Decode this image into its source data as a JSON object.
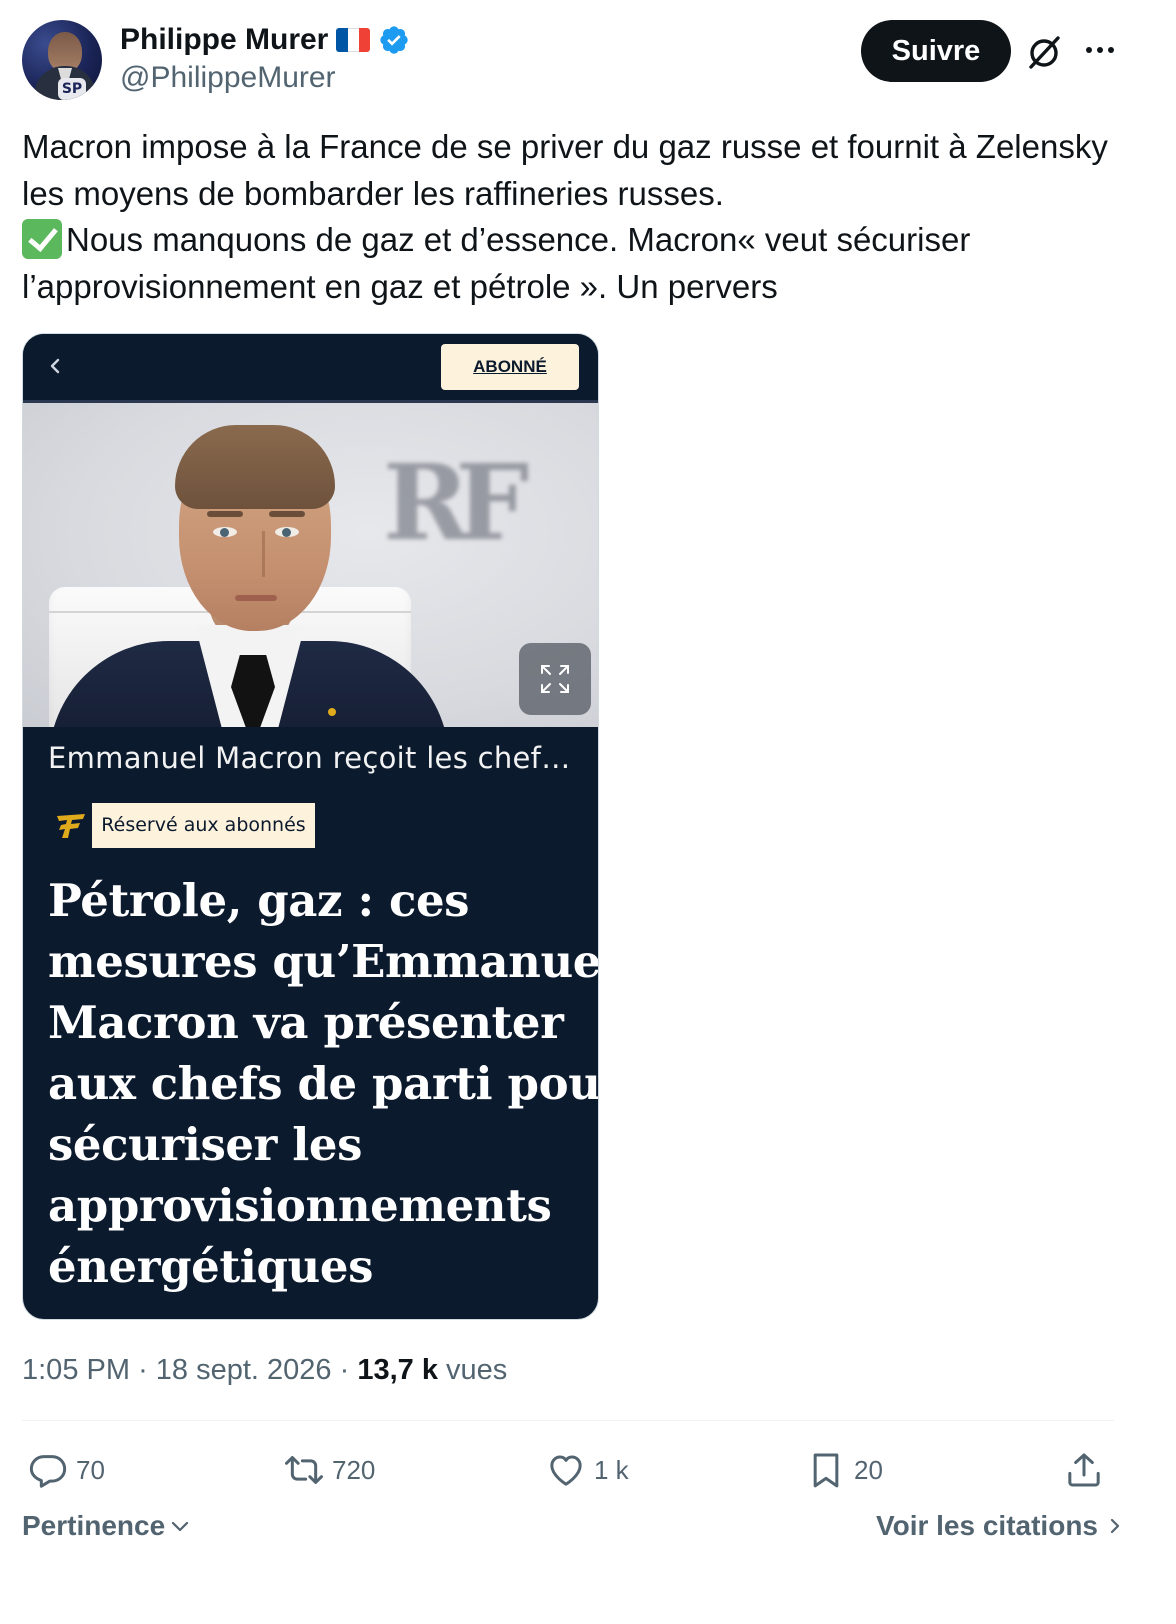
{
  "author": {
    "display_name": "Philippe Murer",
    "handle": "@PhilippeMurer",
    "avatar_badge": "SP",
    "flag_colors": [
      "#0055A4",
      "#FFFFFF",
      "#EF4135"
    ],
    "verified_color": "#1D9BF0"
  },
  "header": {
    "follow_label": "Suivre",
    "grok_icon": "grok-icon",
    "more_icon": "more-icon"
  },
  "tweet": {
    "text_lines": [
      "Macron impose à la France de se priver du gaz russe et fournit à Zelensky",
      "les moyens de bombarder les raffineries russes.",
      "Nous manquons de gaz et d’essence. Macron« veut sécuriser",
      "l’approvisionnement en gaz et pétrole ». Un pervers"
    ]
  },
  "media": {
    "abonne_label": "ABONNÉ",
    "photo_monogram": "RF",
    "caption": "Emmanuel Macron reçoit les chefs de parti",
    "badge": "Réservé aux abonnés",
    "headline_lines": [
      "Pétrole, gaz : ces",
      "mesures qu’Emmanuel",
      "Macron va présenter",
      "aux chefs de parti pour",
      "sécuriser les",
      "approvisionnements",
      "énergétiques"
    ],
    "accent_color": "#E0AA1D",
    "background_color": "#0C1A2E"
  },
  "meta": {
    "time": "1:05 PM",
    "date": "18 sept. 2026",
    "views_count": "13,7 k",
    "views_label": "vues"
  },
  "actions": {
    "replies": "70",
    "reposts": "720",
    "likes": "1 k",
    "bookmarks": "20"
  },
  "footer": {
    "sort_label": "Pertinence",
    "quotes_label": "Voir les citations"
  }
}
